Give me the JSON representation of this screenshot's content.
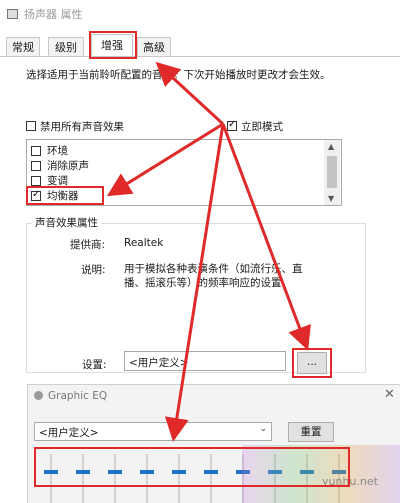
{
  "window": {
    "title": "扬声器 属性"
  },
  "tabs": [
    {
      "label": "常规",
      "active": false
    },
    {
      "label": "级别",
      "active": false
    },
    {
      "label": "增强",
      "active": true
    },
    {
      "label": "高级",
      "active": false
    }
  ],
  "enhancements": {
    "description": "选择适用于当前聆听配置的音效。下次开始播放时更改才会生效。",
    "disable_all_label": "禁用所有声音效果",
    "disable_all_checked": false,
    "immediate_mode_label": "立即模式",
    "immediate_mode_checked": true,
    "effects": [
      {
        "label": "环境",
        "checked": false
      },
      {
        "label": "消除原声",
        "checked": false
      },
      {
        "label": "变调",
        "checked": false
      },
      {
        "label": "均衡器",
        "checked": true
      }
    ]
  },
  "properties": {
    "group_title": "声音效果属性",
    "provider_label": "提供商:",
    "provider_value": "Realtek",
    "info_label": "说明:",
    "info_value": "用于模拟各种表演条件（如流行乐、直播、摇滚乐等）的频率响应的设置",
    "settings_label": "设置:",
    "settings_value": "<用户定义>",
    "more_button": "..."
  },
  "graphic_eq": {
    "title": "Graphic EQ",
    "preset_value": "<用户定义>",
    "reset_button": "重置",
    "close_glyph": "✕",
    "bands": 10
  },
  "watermark": "yunhu.net",
  "colors": {
    "annotation_red": "#e02a2a",
    "eq_blue": "#1e73c8"
  }
}
